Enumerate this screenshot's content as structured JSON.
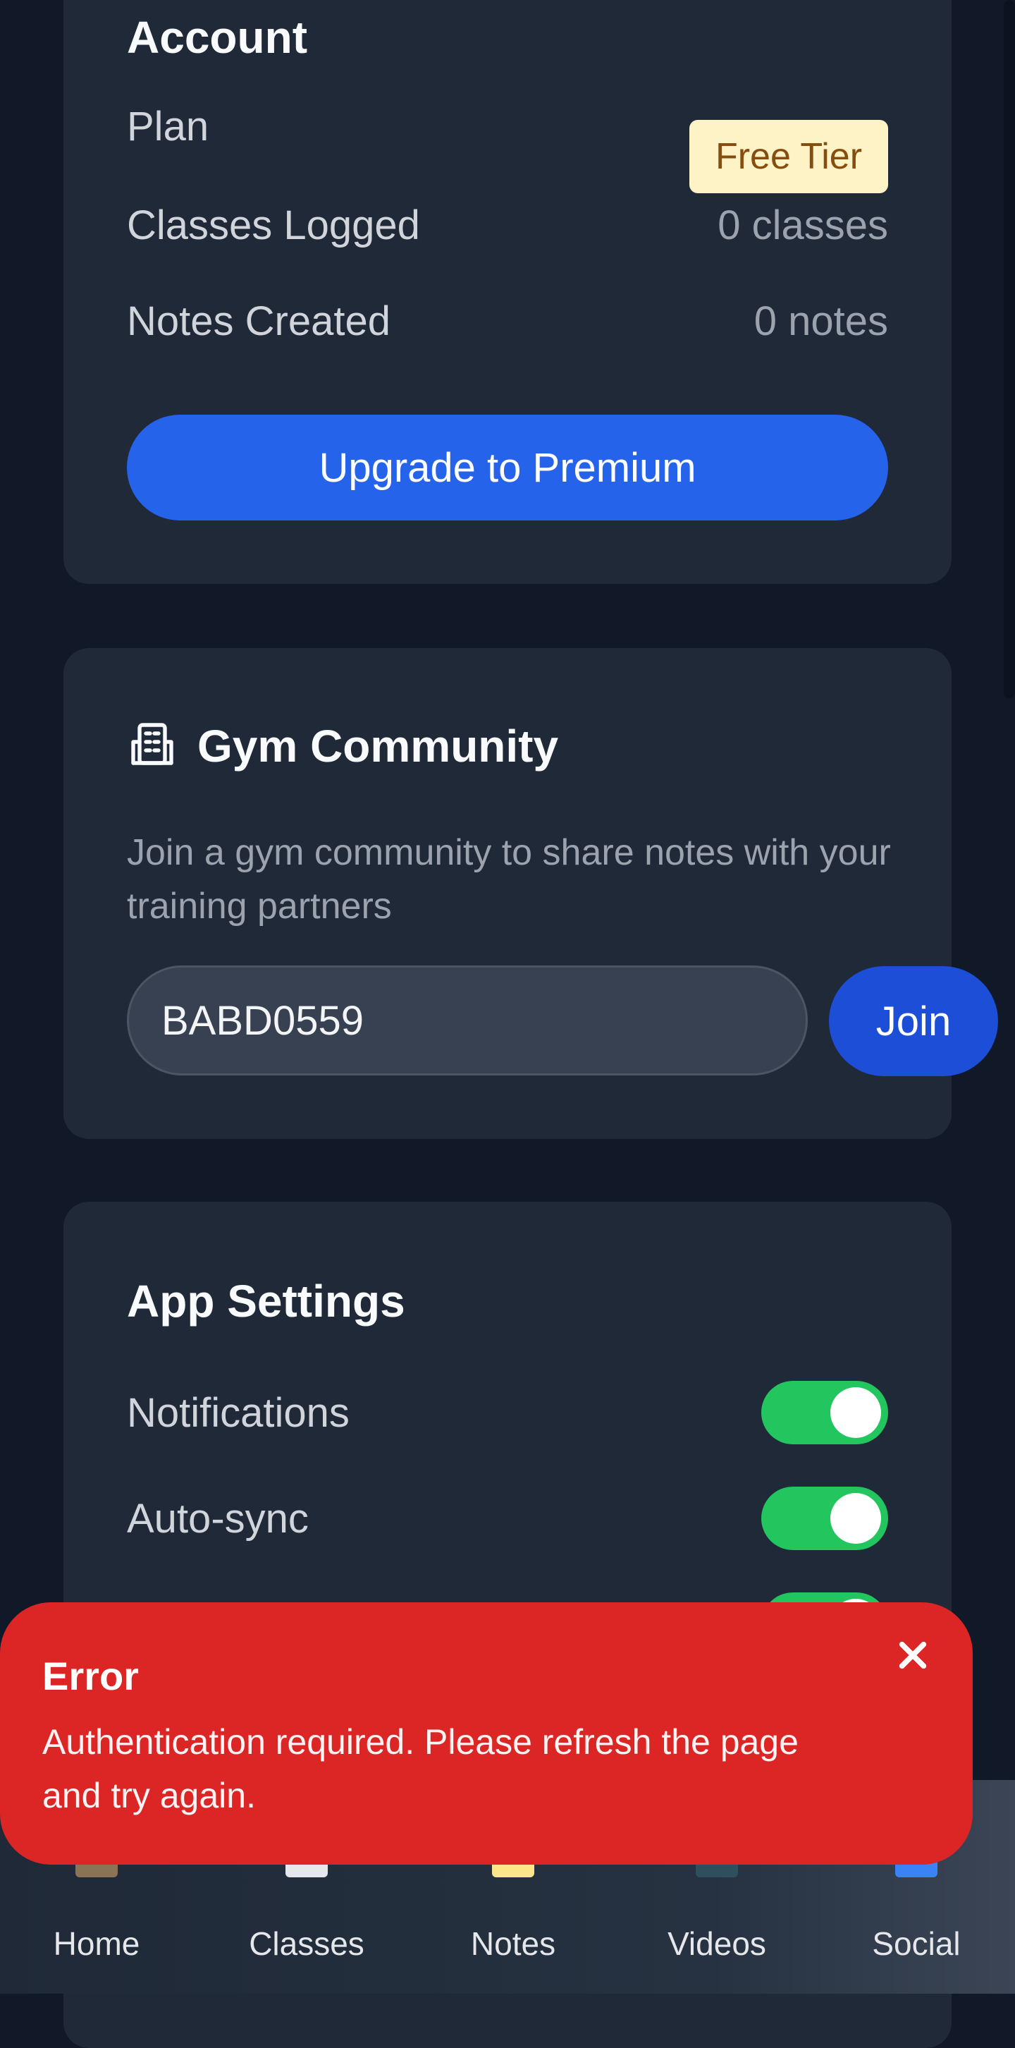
{
  "account": {
    "title": "Account",
    "plan_label": "Plan",
    "plan_badge": "Free Tier",
    "classes_label": "Classes Logged",
    "classes_value": "0 classes",
    "notes_label": "Notes Created",
    "notes_value": "0 notes",
    "upgrade_button": "Upgrade to Premium"
  },
  "gym": {
    "icon": "building-icon",
    "title": "Gym Community",
    "description": "Join a gym community to share notes with your training partners",
    "code_value": "BABD0559",
    "join_button": "Join"
  },
  "settings": {
    "title": "App Settings",
    "notifications_label": "Notifications",
    "notifications_on": true,
    "autosync_label": "Auto-sync",
    "autosync_on": true
  },
  "toast": {
    "title": "Error",
    "message": "Authentication required. Please refresh the page and try again.",
    "close_icon": "close-icon"
  },
  "nav": {
    "items": [
      {
        "label": "Home",
        "icon": "home-icon"
      },
      {
        "label": "Classes",
        "icon": "calendar-icon"
      },
      {
        "label": "Notes",
        "icon": "notes-icon"
      },
      {
        "label": "Videos",
        "icon": "tv-icon"
      },
      {
        "label": "Social",
        "icon": "people-icon"
      }
    ]
  },
  "colors": {
    "accent": "#2563eb",
    "toggle_on": "#22c55e",
    "error": "#dc2626",
    "badge_bg": "#fef3c7"
  }
}
